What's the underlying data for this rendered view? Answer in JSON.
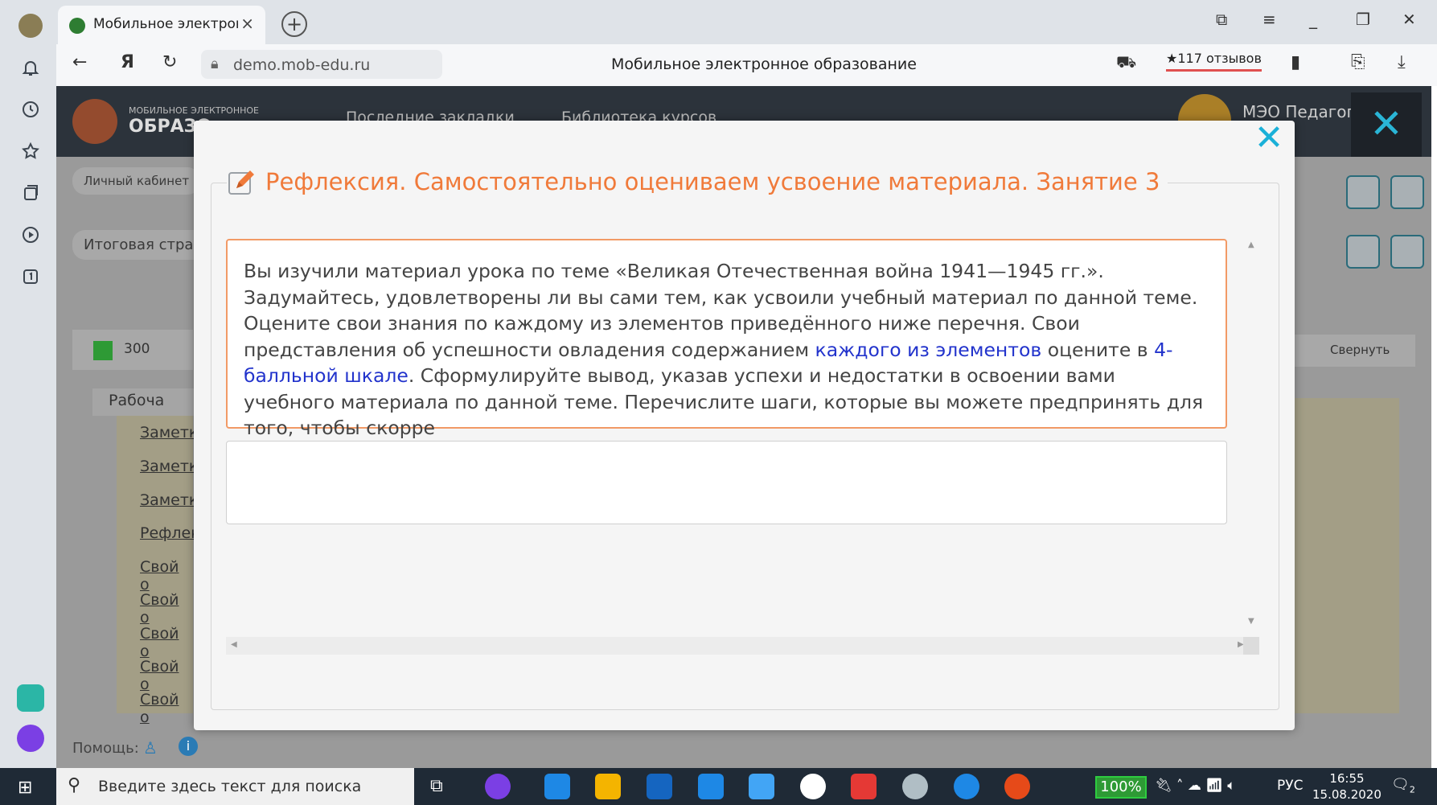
{
  "browser": {
    "tab_title": "Мобильное электронное образование",
    "tab_close": "×",
    "new_tab": "+",
    "url": "demo.mob-edu.ru",
    "page_title": "Мобильное электронное образование",
    "reviews": "★117 отзывов",
    "window_controls": {
      "minimize": "_",
      "restore": "❐",
      "close": "✕"
    }
  },
  "site": {
    "brand_small": "МОБИЛЬНОЕ ЭЛЕКТРОННОЕ",
    "brand_big": "ОБРАЗО",
    "nav_bookmarks": "Последние закладки",
    "nav_library": "Библиотека курсов",
    "user_name": "МЭО Педагог",
    "breadcrumb_cabinet": "Личный кабинет",
    "final_page": "Итоговая страни",
    "class_label": "300",
    "collapse_label": "Свернуть",
    "section_label": "Рабоча",
    "list_links": [
      "Заметк",
      "Заметк",
      "Заметк",
      "Рефлек",
      "Свой о",
      "Свой о",
      "Свой о",
      "Свой о",
      "Свой о"
    ],
    "help_label": "Помощь:"
  },
  "modal": {
    "close_icon": "✕",
    "heading": "Рефлексия. Самостоятельно оцениваем усвоение материала. Занятие 3",
    "question_part1": "Вы изучили материал урока по теме «Великая Отечественная война 1941—1945 гг.». Задумайтесь, удовлетворены ли вы сами тем, как усвоили учебный материал по данной теме. Оцените свои знания по каждому из элементов приведённого ниже перечня. Свои представления об успешности овладения содержанием ",
    "question_link1": "каждого из элементов",
    "question_part2": " оцените в ",
    "question_link2": "4-балльной шкале",
    "question_part3": ". Сформулируйте вывод, указав успехи и недостатки в освоении вами учебного материала по данной теме. Перечислите шаги, которые вы можете предпринять для того, чтобы скорре",
    "answer_value": ""
  },
  "taskbar": {
    "search_placeholder": "Введите здесь текст для поиска",
    "battery": "100%",
    "language": "РУС",
    "time": "16:55",
    "date": "15.08.2020",
    "notifications": "2"
  },
  "colors": {
    "accent_orange": "#f07a3a",
    "accent_blue": "#1ab0d8",
    "link_blue": "#2233cc"
  }
}
